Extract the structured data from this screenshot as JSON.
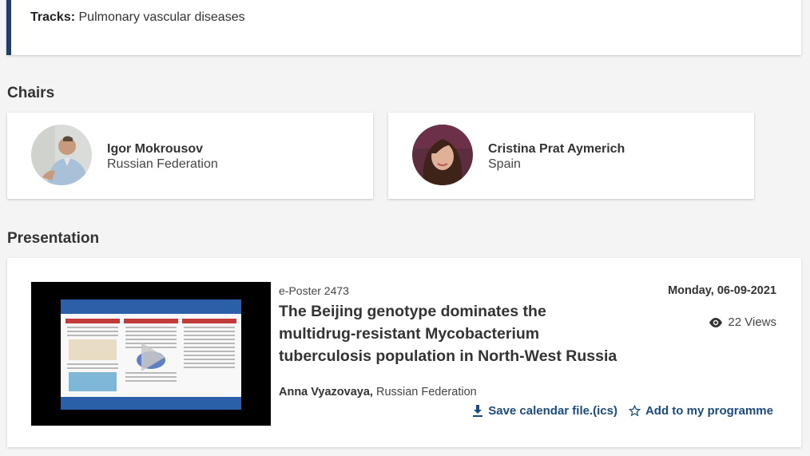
{
  "tracks": {
    "label": "Tracks:",
    "value": "Pulmonary vascular diseases"
  },
  "chairs": {
    "title": "Chairs",
    "items": [
      {
        "name": "Igor Mokrousov",
        "country": "Russian Federation"
      },
      {
        "name": "Cristina Prat Aymerich",
        "country": "Spain"
      }
    ]
  },
  "presentation": {
    "title": "Presentation",
    "poster_id": "e-Poster 2473",
    "paper_title": "The Beijing genotype dominates the multidrug-resistant Mycobacterium tuberculosis population in North-West Russia",
    "author_name": "Anna Vyazovaya,",
    "author_country": "Russian Federation",
    "date": "Monday, 06-09-2021",
    "views": "22 Views",
    "save_calendar_label": "Save calendar file.(ics)",
    "add_programme_label": "Add to my programme"
  },
  "colors": {
    "accent": "#1b4b7e",
    "track_border": "#1f3f6b"
  },
  "icons": {
    "views": "eye-icon",
    "save": "download-icon",
    "add": "star-outline-icon",
    "play": "play-icon"
  }
}
